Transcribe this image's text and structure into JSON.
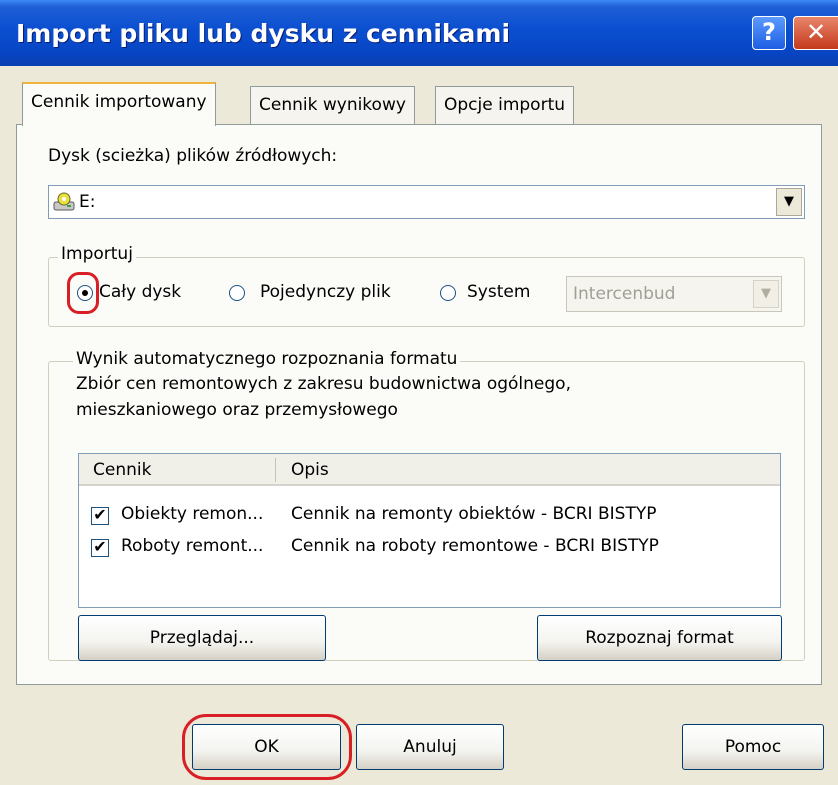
{
  "window": {
    "title": "Import pliku lub dysku z cennikami",
    "help_glyph": "?",
    "close_glyph": "✕"
  },
  "tabs": [
    {
      "label": "Cennik importowany",
      "active": true
    },
    {
      "label": "Cennik wynikowy",
      "active": false
    },
    {
      "label": "Opcje importu",
      "active": false
    }
  ],
  "source": {
    "label": "Dysk (scieżka) plików źródłowych:",
    "value": "E:",
    "arrow": "▼"
  },
  "import_group": {
    "legend": "Importuj",
    "options": [
      {
        "label": "Cały dysk",
        "checked": true
      },
      {
        "label": "Pojedynczy plik",
        "checked": false
      },
      {
        "label": "System",
        "checked": false
      }
    ],
    "system_value": "Intercenbud",
    "arrow": "▼"
  },
  "recognition": {
    "legend": "Wynik automatycznego rozpoznania formatu",
    "line1": "Zbiór cen remontowych z zakresu budownictwa ogólnego,",
    "line2": "mieszkaniowego oraz przemysłowego",
    "columns": [
      "Cennik",
      "Opis"
    ],
    "rows": [
      {
        "name": "Obiekty remon...",
        "desc": "Cennik na remonty obiektów - BCRI BISTYP",
        "checked": true
      },
      {
        "name": "Roboty remont...",
        "desc": "Cennik na roboty remontowe - BCRI BISTYP",
        "checked": true
      }
    ],
    "check_glyph": "✔",
    "browse_label": "Przeglądaj...",
    "detect_label": "Rozpoznaj format"
  },
  "footer": {
    "ok_label": "OK",
    "cancel_label": "Anuluj",
    "help_label": "Pomoc"
  },
  "colors": {
    "title_bar": "#0a4fd0",
    "highlight": "#d81f26",
    "dialog_bg": "#ece9d8"
  }
}
